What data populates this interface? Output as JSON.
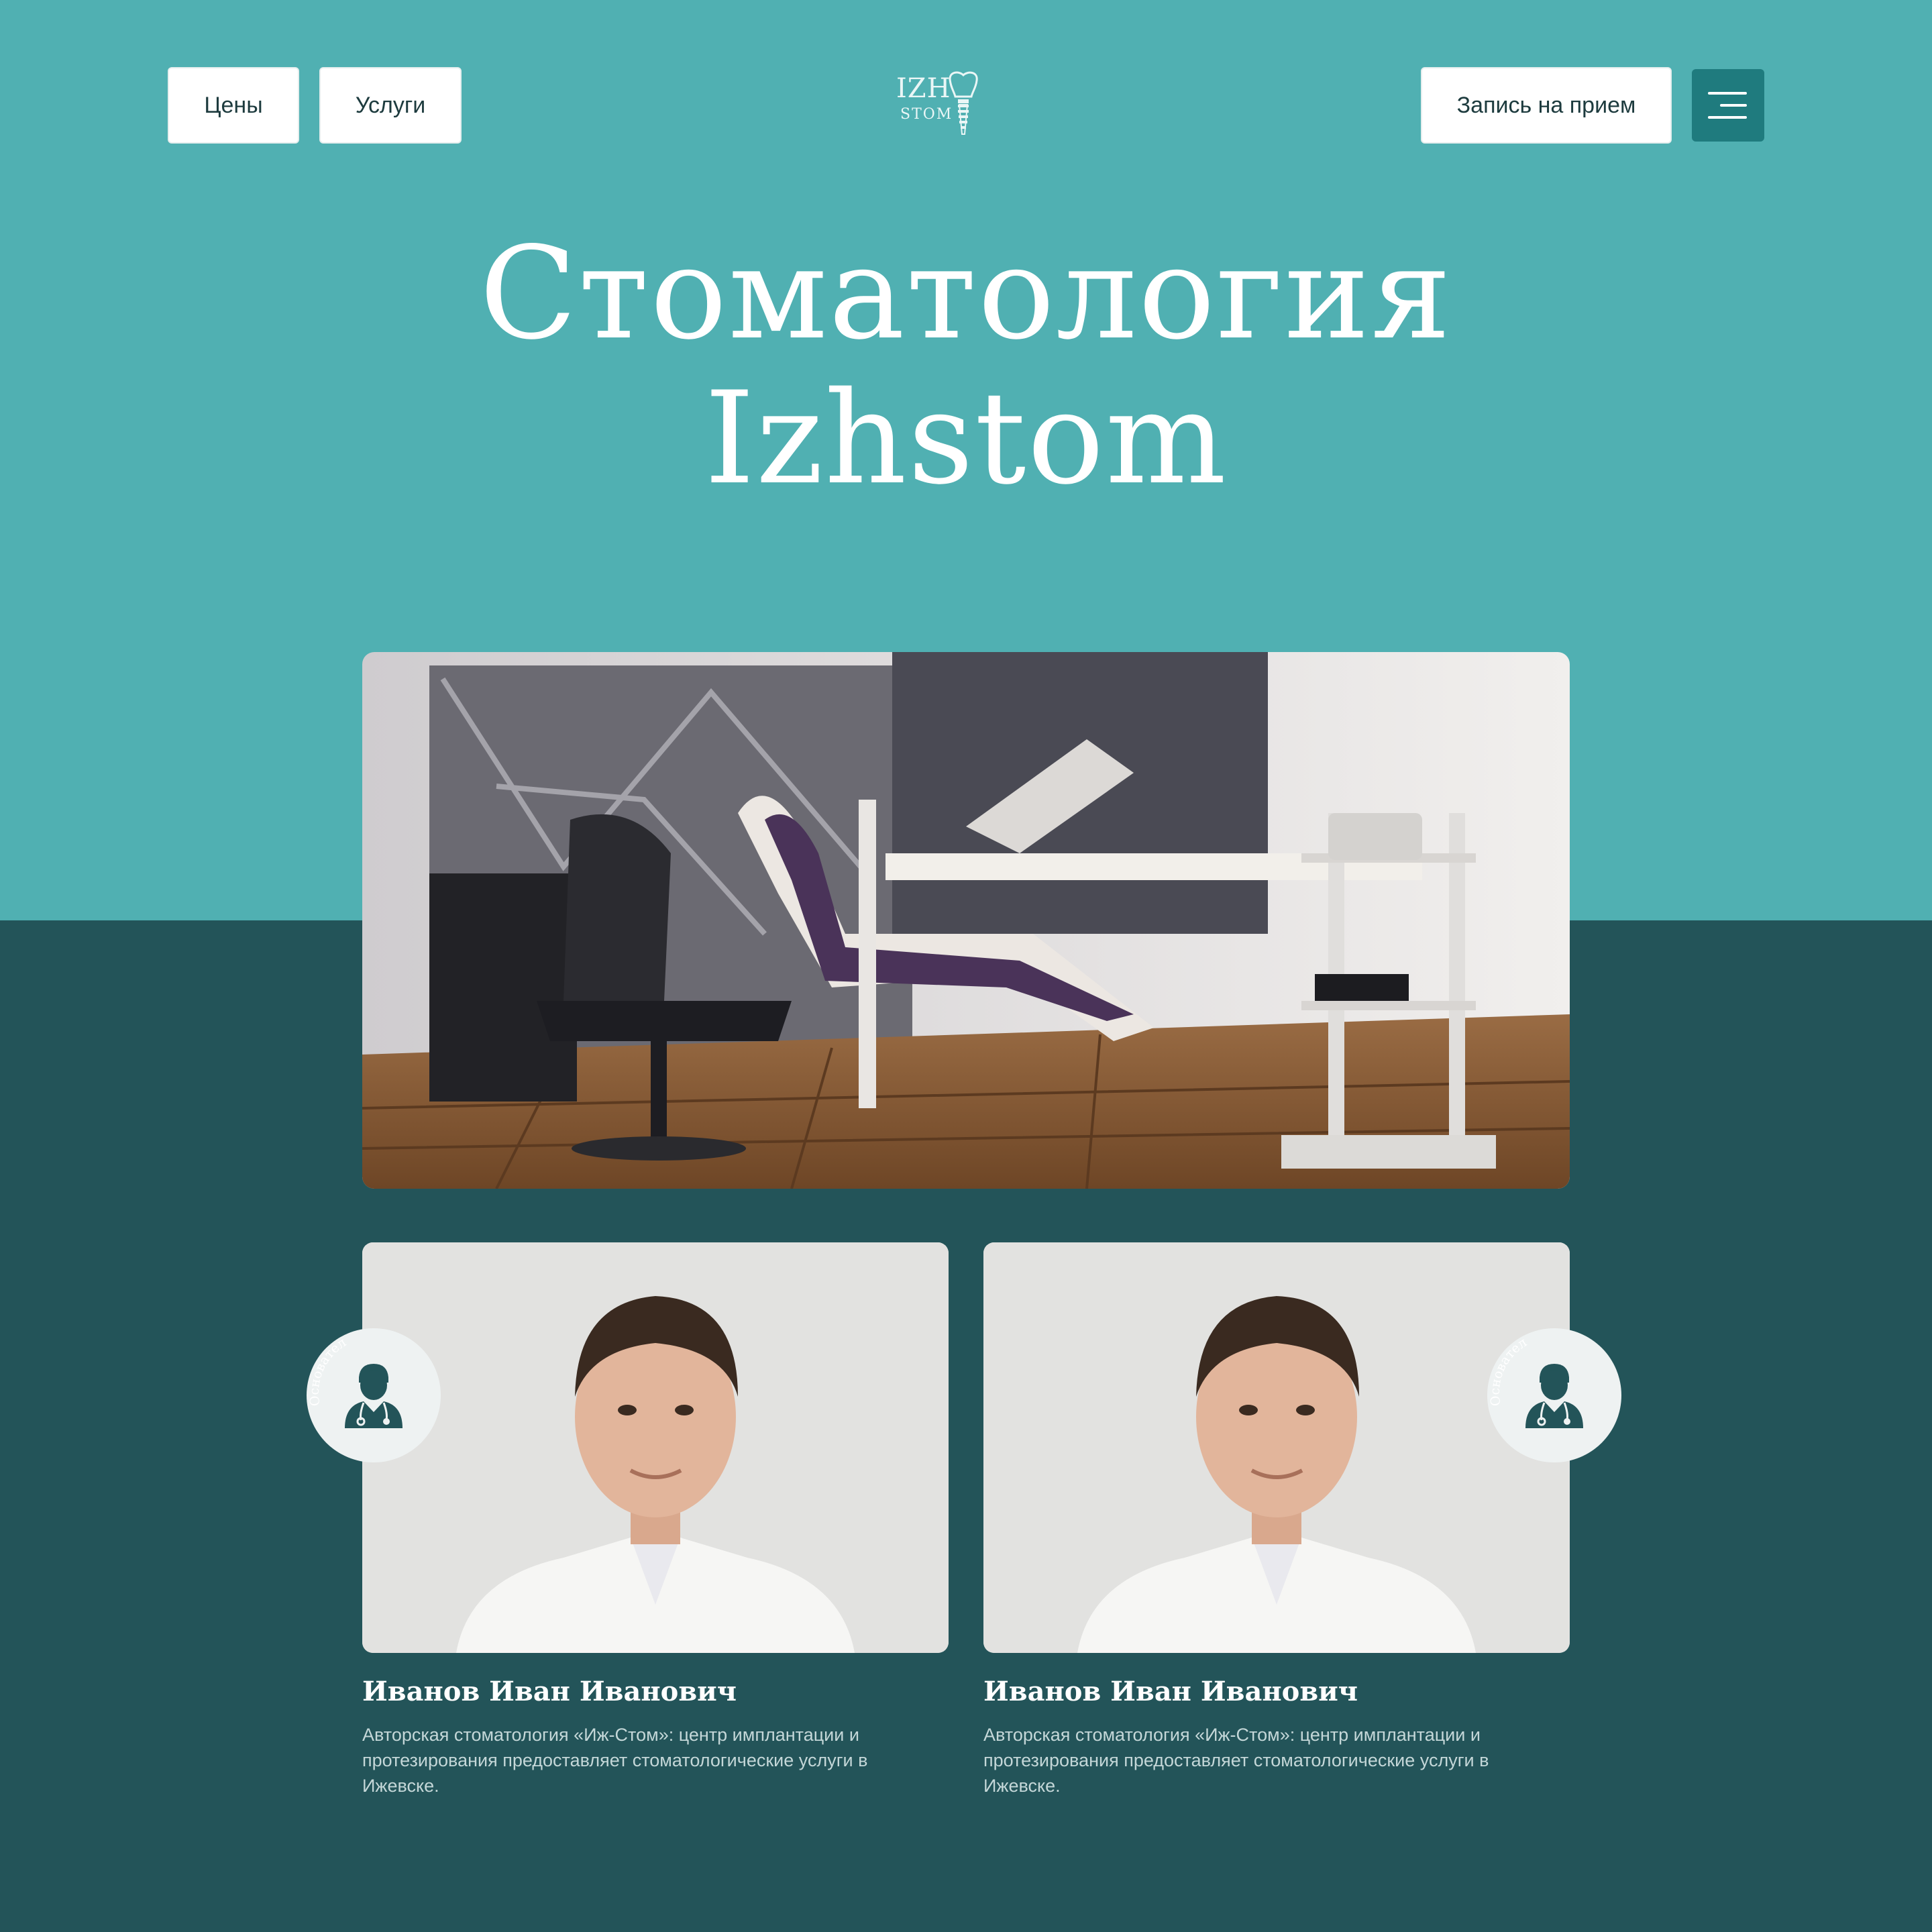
{
  "nav": {
    "prices_label": "Цены",
    "services_label": "Услуги",
    "appointment_label": "Запись на прием"
  },
  "logo": {
    "line1": "IZH",
    "line2": "STOM"
  },
  "hero": {
    "title_line1": "Стоматология",
    "title_line2": "Izhstom"
  },
  "doctors": [
    {
      "name": "Иванов Иван Иванович",
      "description": "Авторская стоматология «Иж-Стом»: центр имплантации и протезирования предоставляет стоматологические услуги в Ижевске.",
      "badge_text": "Основател"
    },
    {
      "name": "Иванов Иван Иванович",
      "description": "Авторская стоматология «Иж-Стом»: центр имплантации и протезирования предоставляет стоматологические услуги в Ижевске.",
      "badge_text": "Основател"
    }
  ],
  "colors": {
    "top_band": "#50b0b2",
    "bottom_band": "#235459",
    "menu_button": "#1f7b7e"
  },
  "icons": [
    "tooth-implant-icon",
    "menu-icon",
    "doctor-icon"
  ]
}
